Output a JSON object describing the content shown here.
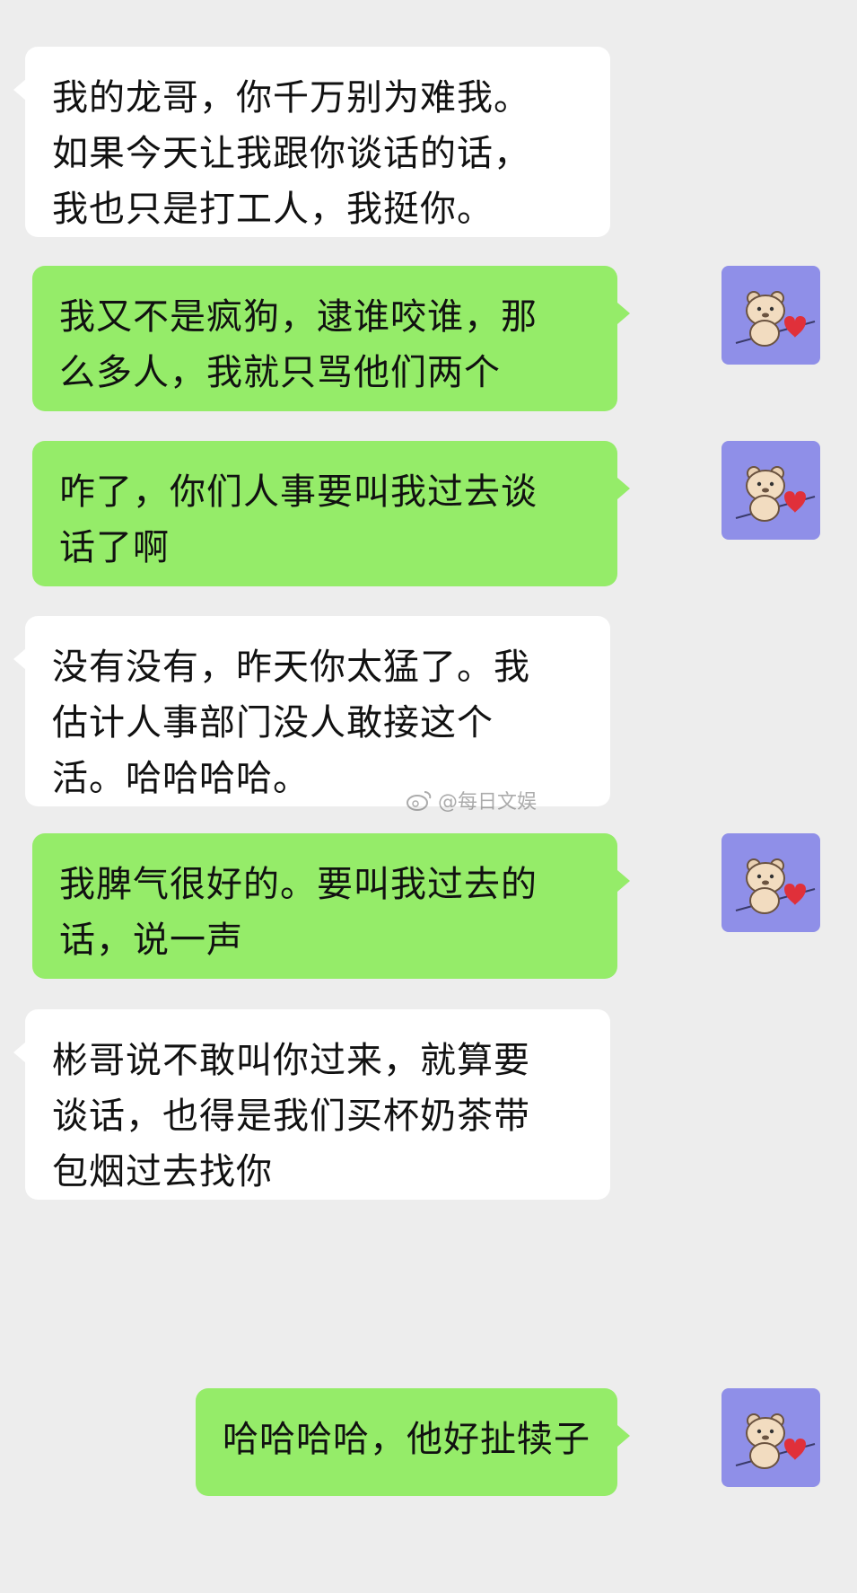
{
  "colors": {
    "background": "#ededed",
    "incoming_bubble": "#ffffff",
    "outgoing_bubble": "#95ec69",
    "avatar_background": "#8f8fe8",
    "text": "#111111"
  },
  "avatar": {
    "icon": "bear-with-heart-icon"
  },
  "messages": [
    {
      "side": "incoming",
      "text": "我的龙哥，你千万别为难我。\n如果今天让我跟你谈话的话，\n我也只是打工人，我挺你。"
    },
    {
      "side": "outgoing",
      "text": "我又不是疯狗，逮谁咬谁，那\n么多人，我就只骂他们两个"
    },
    {
      "side": "outgoing",
      "text": "咋了，你们人事要叫我过去谈\n话了啊"
    },
    {
      "side": "incoming",
      "text": "没有没有，昨天你太猛了。我\n估计人事部门没人敢接这个\n活。哈哈哈哈。"
    },
    {
      "side": "outgoing",
      "text": "我脾气很好的。要叫我过去的\n话，说一声"
    },
    {
      "side": "incoming",
      "text": "彬哥说不敢叫你过来，就算要\n谈话，也得是我们买杯奶茶带\n包烟过去找你"
    },
    {
      "side": "outgoing",
      "text": "哈哈哈哈，他好扯犊子"
    }
  ],
  "watermark": {
    "icon": "weibo-icon",
    "text": "@每日文娱"
  }
}
